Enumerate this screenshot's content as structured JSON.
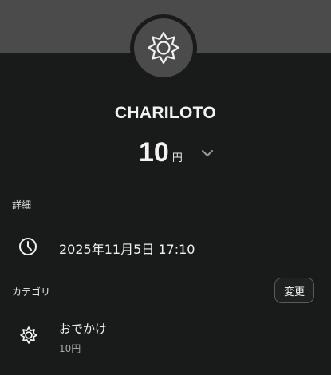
{
  "header": {
    "icon": "sun-icon",
    "title": "CHARILOTO"
  },
  "amount": {
    "value": "10",
    "unit": "円",
    "expand_icon": "chevron-down-icon"
  },
  "details": {
    "section_label": "詳細",
    "datetime_icon": "clock-icon",
    "datetime": "2025年11月5日 17:10"
  },
  "category": {
    "section_label": "カテゴリ",
    "change_label": "変更",
    "icon": "sun-icon",
    "name": "おでかけ",
    "amount": "10円"
  },
  "colors": {
    "background": "#191b1a",
    "header_band": "#4a4b4a",
    "text": "#f3f3f3",
    "muted_text": "#a9aaa9"
  }
}
